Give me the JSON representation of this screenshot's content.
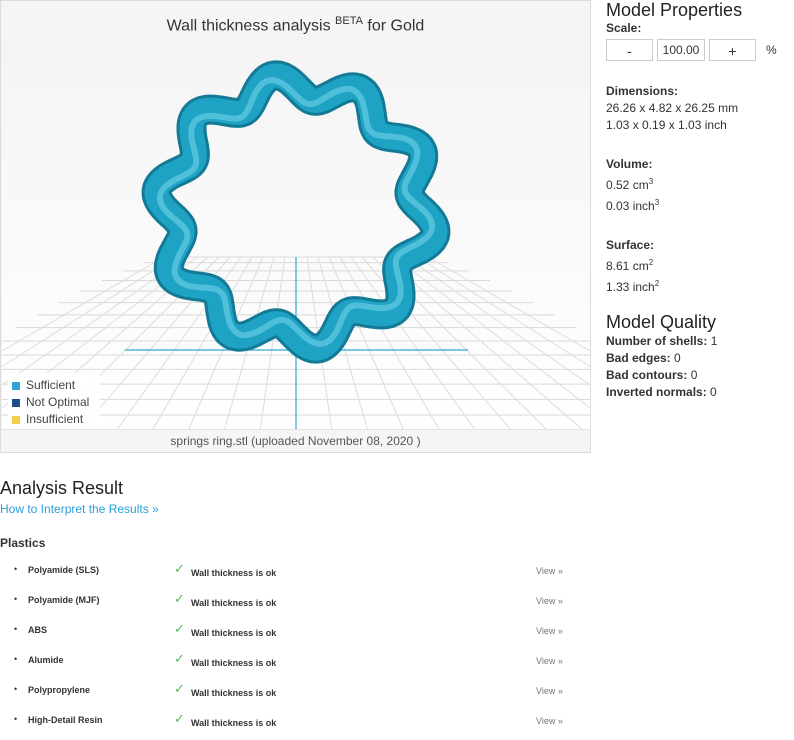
{
  "viewer": {
    "title_prefix": "Wall thickness analysis",
    "title_sup": "BETA",
    "title_suffix": "for Gold",
    "file_info": "springs ring.stl (uploaded November 08, 2020 )",
    "legend": [
      {
        "label": "Sufficient",
        "color": "#29a8d8"
      },
      {
        "label": "Not Optimal",
        "color": "#1a4f8a"
      },
      {
        "label": "Insufficient",
        "color": "#f2cf4a"
      }
    ],
    "model_color": "#1fa3c4"
  },
  "properties": {
    "title": "Model Properties",
    "scale_label": "Scale:",
    "scale_minus": "-",
    "scale_value": "100.00",
    "scale_plus": "+",
    "scale_unit": "%",
    "dimensions_label": "Dimensions:",
    "dimensions_mm": "26.26 x 4.82 x 26.25 mm",
    "dimensions_inch": "1.03 x 0.19 x 1.03 inch",
    "volume_label": "Volume:",
    "volume_cm": "0.52 cm",
    "volume_inch": "0.03 inch",
    "volume_exp": "3",
    "surface_label": "Surface:",
    "surface_cm": "8.61 cm",
    "surface_inch": "1.33 inch",
    "surface_exp": "2"
  },
  "quality": {
    "title": "Model Quality",
    "shells_label": "Number of shells:",
    "shells_value": "1",
    "bad_edges_label": "Bad edges:",
    "bad_edges_value": "0",
    "bad_contours_label": "Bad contours:",
    "bad_contours_value": "0",
    "inverted_label": "Inverted normals:",
    "inverted_value": "0"
  },
  "analysis": {
    "title": "Analysis Result",
    "interpret_link": "How to Interpret the Results »",
    "group_title": "Plastics",
    "status_text": "Wall thickness is ok",
    "view_text": "View »",
    "materials": [
      "Polyamide (SLS)",
      "Polyamide (MJF)",
      "ABS",
      "Alumide",
      "Polypropylene",
      "High-Detail Resin"
    ]
  }
}
